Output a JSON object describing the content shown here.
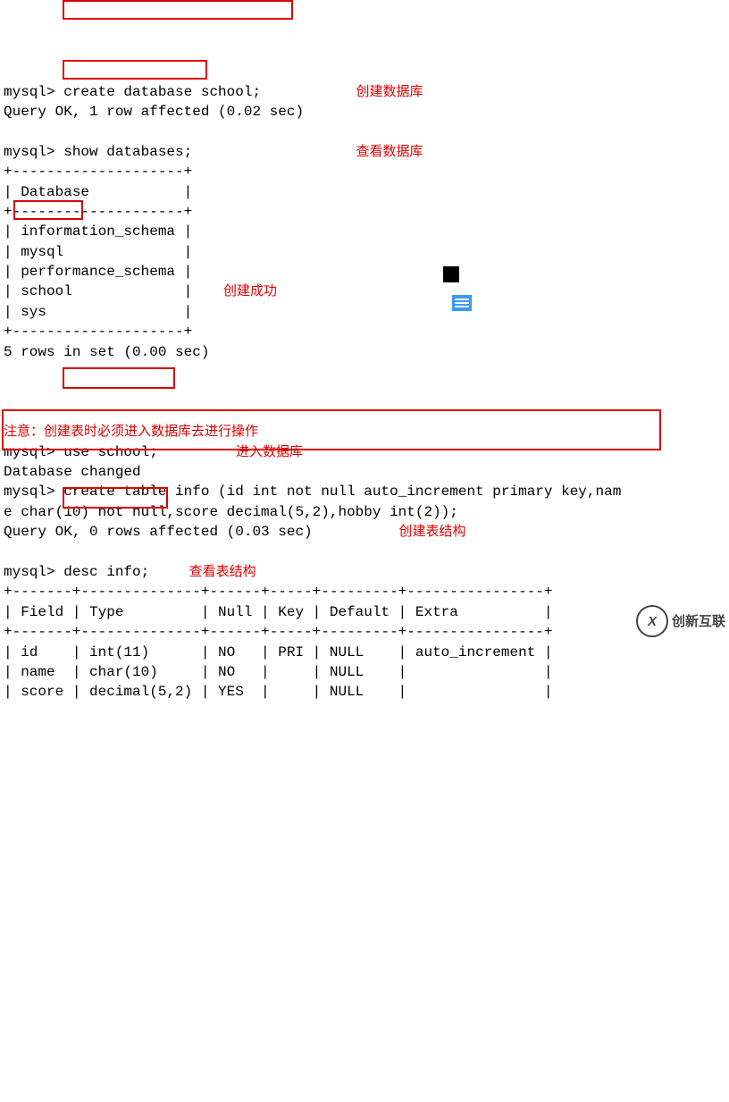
{
  "l1_prompt": "mysql>",
  "l1_cmd": " create database school;",
  "l1_anno": "创建数据库",
  "l2": "Query OK, 1 row affected (0.02 sec)",
  "l4_prompt": "mysql>",
  "l4_cmd": " show databases;",
  "l4_anno": "查看数据库",
  "l5": "+--------------------+",
  "l6": "| Database           |",
  "l7": "+--------------------+",
  "l8": "| information_schema |",
  "l9": "| mysql              |",
  "l10": "| performance_schema |",
  "l11a": "| ",
  "l11b": "school",
  "l11c": "             |",
  "l11_anno": "创建成功",
  "l12": "| sys                |",
  "l13": "+--------------------+",
  "l14": "5 rows in set (0.00 sec)",
  "note": "注意：创建表时必须进入数据库去进行操作",
  "l18_prompt": "mysql>",
  "l18_cmd": " use school;",
  "l18_anno": "进入数据库",
  "l19": "Database changed",
  "l20a": "mysql>",
  "l20b": " create table info (id int not null auto_increment primary key,nam",
  "l21": "e char(10) not null,score decimal(5,2),hobby int(2));",
  "l22a": "Query OK, 0 rows affected (0.03 sec)",
  "l22_anno": "创建表结构",
  "l24_prompt": "mysql>",
  "l24_cmd": " desc info;",
  "l24_anno": "查看表结构",
  "l25": "+-------+--------------+------+-----+---------+----------------+",
  "l26": "| Field | Type         | Null | Key | Default | Extra          |",
  "l27": "+-------+--------------+------+-----+---------+----------------+",
  "l28": "| id    | int(11)      | NO   | PRI | NULL    | auto_increment |",
  "l29": "| name  | char(10)     | NO   |     | NULL    |                |",
  "l30": "| score | decimal(5,2) | YES  |     | NULL    |                |",
  "wm": "创新互联"
}
